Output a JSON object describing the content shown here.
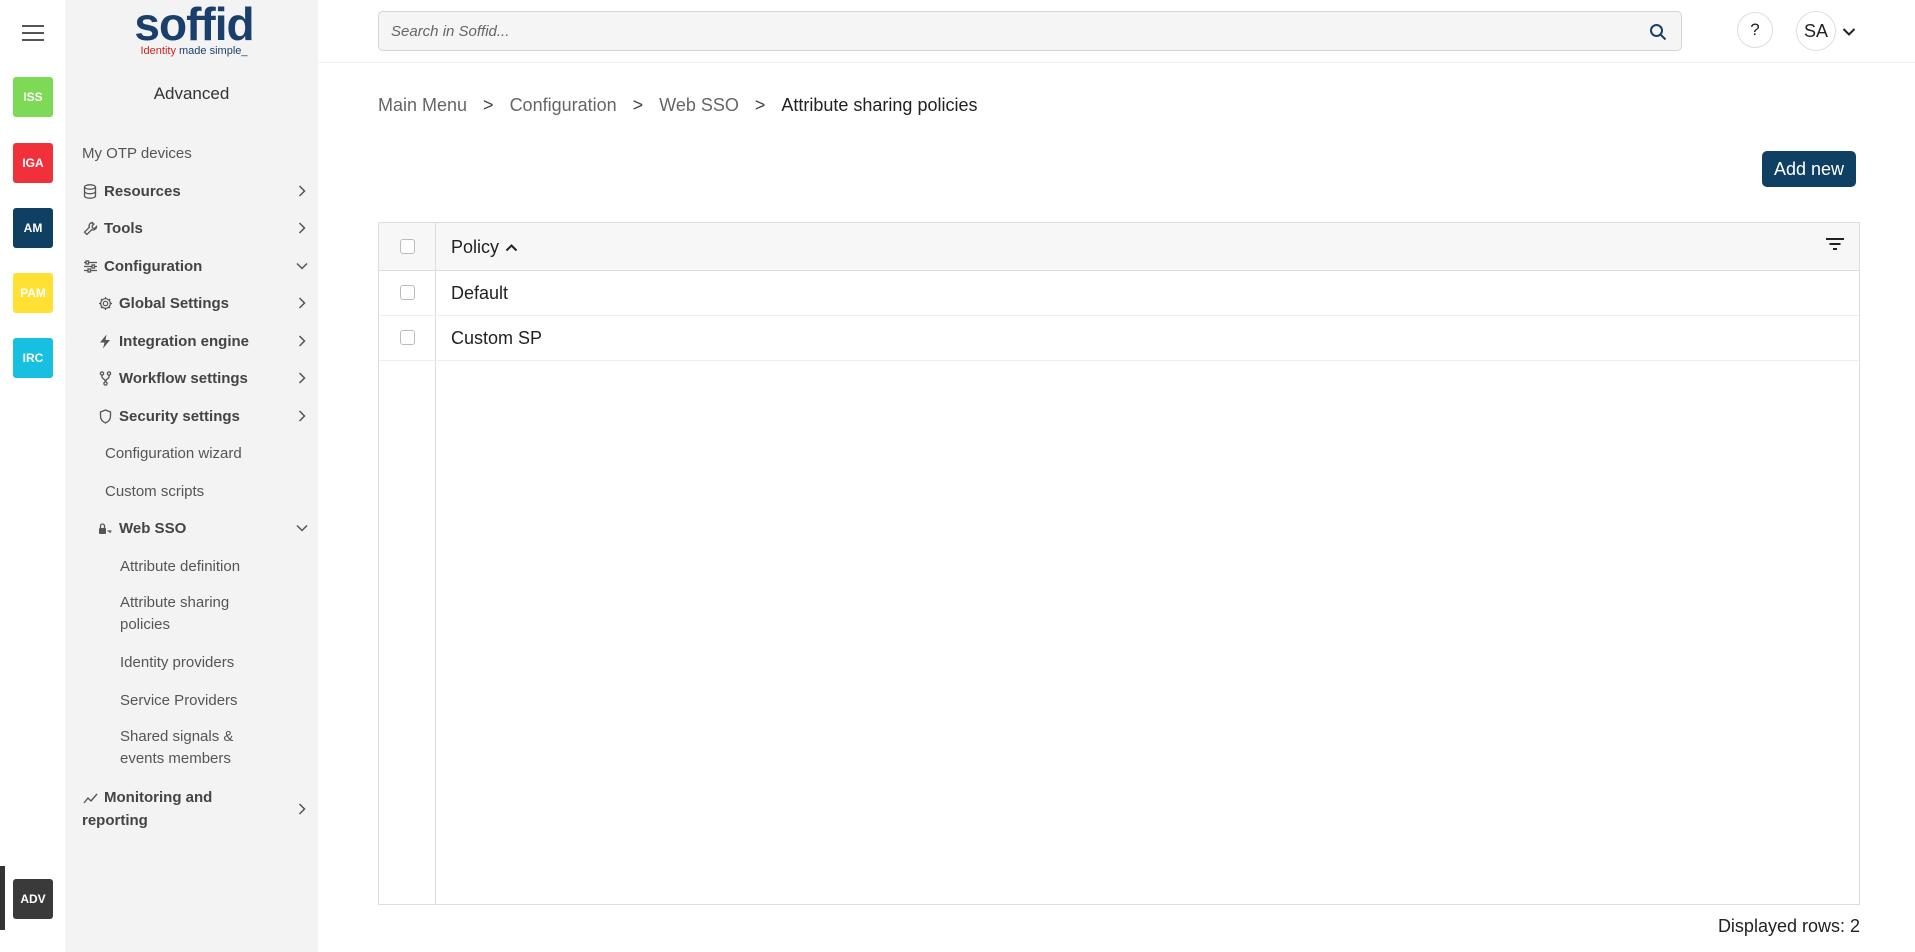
{
  "rail": {
    "apps": [
      {
        "label": "ISS",
        "color": "#7ed957"
      },
      {
        "label": "IGA",
        "color": "#f0313b"
      },
      {
        "label": "AM",
        "color": "#0f3f63"
      },
      {
        "label": "PAM",
        "color": "#ffe033"
      },
      {
        "label": "IRC",
        "color": "#17c0e0"
      },
      {
        "label": "ADV",
        "color": "#3a3a3a"
      }
    ]
  },
  "sidebar": {
    "logo_text": "soffid",
    "logo_tag_red": "Identity",
    "logo_tag_blue": "made simple_",
    "section_title": "Advanced",
    "items": [
      {
        "label": "My OTP devices"
      },
      {
        "label": "Resources",
        "icon": "database-icon"
      },
      {
        "label": "Tools",
        "icon": "wrench-icon"
      },
      {
        "label": "Configuration",
        "icon": "sliders-icon"
      },
      {
        "label": "Global Settings",
        "icon": "gear-icon"
      },
      {
        "label": "Integration engine",
        "icon": "bolt-icon"
      },
      {
        "label": "Workflow settings",
        "icon": "fork-icon"
      },
      {
        "label": "Security settings",
        "icon": "shield-icon"
      },
      {
        "label": "Configuration wizard"
      },
      {
        "label": "Custom scripts"
      },
      {
        "label": "Web SSO",
        "icon": "lock-key-icon"
      },
      {
        "label": "Attribute definition"
      },
      {
        "label": "Attribute sharing policies"
      },
      {
        "label": "Identity providers"
      },
      {
        "label": "Service Providers"
      },
      {
        "label": "Shared signals & events members"
      },
      {
        "label": "Monitoring and reporting",
        "icon": "chart-line-icon"
      }
    ]
  },
  "header": {
    "search_placeholder": "Search in Soffid...",
    "help_label": "?",
    "avatar_initials": "SA"
  },
  "breadcrumb": {
    "items": [
      "Main Menu",
      "Configuration",
      "Web SSO",
      "Attribute sharing policies"
    ],
    "separator": ">"
  },
  "actions": {
    "add_new_label": "Add new"
  },
  "table": {
    "column_policy": "Policy",
    "rows": [
      {
        "policy": "Default"
      },
      {
        "policy": "Custom SP"
      }
    ]
  },
  "footer": {
    "displayed_rows": "Displayed rows: 2"
  }
}
